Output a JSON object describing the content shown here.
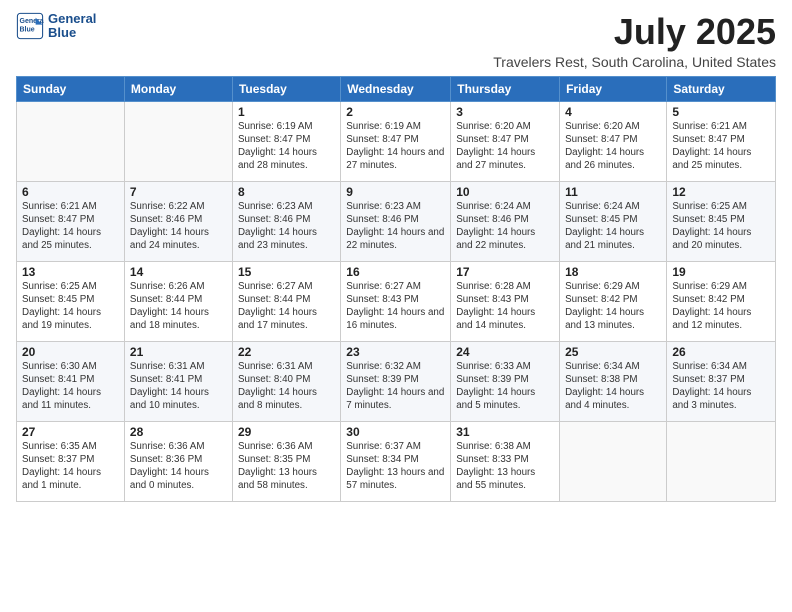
{
  "logo": {
    "line1": "General",
    "line2": "Blue"
  },
  "title": "July 2025",
  "subtitle": "Travelers Rest, South Carolina, United States",
  "days_of_week": [
    "Sunday",
    "Monday",
    "Tuesday",
    "Wednesday",
    "Thursday",
    "Friday",
    "Saturday"
  ],
  "weeks": [
    [
      {
        "day": "",
        "info": ""
      },
      {
        "day": "",
        "info": ""
      },
      {
        "day": "1",
        "info": "Sunrise: 6:19 AM\nSunset: 8:47 PM\nDaylight: 14 hours and 28 minutes."
      },
      {
        "day": "2",
        "info": "Sunrise: 6:19 AM\nSunset: 8:47 PM\nDaylight: 14 hours and 27 minutes."
      },
      {
        "day": "3",
        "info": "Sunrise: 6:20 AM\nSunset: 8:47 PM\nDaylight: 14 hours and 27 minutes."
      },
      {
        "day": "4",
        "info": "Sunrise: 6:20 AM\nSunset: 8:47 PM\nDaylight: 14 hours and 26 minutes."
      },
      {
        "day": "5",
        "info": "Sunrise: 6:21 AM\nSunset: 8:47 PM\nDaylight: 14 hours and 25 minutes."
      }
    ],
    [
      {
        "day": "6",
        "info": "Sunrise: 6:21 AM\nSunset: 8:47 PM\nDaylight: 14 hours and 25 minutes."
      },
      {
        "day": "7",
        "info": "Sunrise: 6:22 AM\nSunset: 8:46 PM\nDaylight: 14 hours and 24 minutes."
      },
      {
        "day": "8",
        "info": "Sunrise: 6:23 AM\nSunset: 8:46 PM\nDaylight: 14 hours and 23 minutes."
      },
      {
        "day": "9",
        "info": "Sunrise: 6:23 AM\nSunset: 8:46 PM\nDaylight: 14 hours and 22 minutes."
      },
      {
        "day": "10",
        "info": "Sunrise: 6:24 AM\nSunset: 8:46 PM\nDaylight: 14 hours and 22 minutes."
      },
      {
        "day": "11",
        "info": "Sunrise: 6:24 AM\nSunset: 8:45 PM\nDaylight: 14 hours and 21 minutes."
      },
      {
        "day": "12",
        "info": "Sunrise: 6:25 AM\nSunset: 8:45 PM\nDaylight: 14 hours and 20 minutes."
      }
    ],
    [
      {
        "day": "13",
        "info": "Sunrise: 6:25 AM\nSunset: 8:45 PM\nDaylight: 14 hours and 19 minutes."
      },
      {
        "day": "14",
        "info": "Sunrise: 6:26 AM\nSunset: 8:44 PM\nDaylight: 14 hours and 18 minutes."
      },
      {
        "day": "15",
        "info": "Sunrise: 6:27 AM\nSunset: 8:44 PM\nDaylight: 14 hours and 17 minutes."
      },
      {
        "day": "16",
        "info": "Sunrise: 6:27 AM\nSunset: 8:43 PM\nDaylight: 14 hours and 16 minutes."
      },
      {
        "day": "17",
        "info": "Sunrise: 6:28 AM\nSunset: 8:43 PM\nDaylight: 14 hours and 14 minutes."
      },
      {
        "day": "18",
        "info": "Sunrise: 6:29 AM\nSunset: 8:42 PM\nDaylight: 14 hours and 13 minutes."
      },
      {
        "day": "19",
        "info": "Sunrise: 6:29 AM\nSunset: 8:42 PM\nDaylight: 14 hours and 12 minutes."
      }
    ],
    [
      {
        "day": "20",
        "info": "Sunrise: 6:30 AM\nSunset: 8:41 PM\nDaylight: 14 hours and 11 minutes."
      },
      {
        "day": "21",
        "info": "Sunrise: 6:31 AM\nSunset: 8:41 PM\nDaylight: 14 hours and 10 minutes."
      },
      {
        "day": "22",
        "info": "Sunrise: 6:31 AM\nSunset: 8:40 PM\nDaylight: 14 hours and 8 minutes."
      },
      {
        "day": "23",
        "info": "Sunrise: 6:32 AM\nSunset: 8:39 PM\nDaylight: 14 hours and 7 minutes."
      },
      {
        "day": "24",
        "info": "Sunrise: 6:33 AM\nSunset: 8:39 PM\nDaylight: 14 hours and 5 minutes."
      },
      {
        "day": "25",
        "info": "Sunrise: 6:34 AM\nSunset: 8:38 PM\nDaylight: 14 hours and 4 minutes."
      },
      {
        "day": "26",
        "info": "Sunrise: 6:34 AM\nSunset: 8:37 PM\nDaylight: 14 hours and 3 minutes."
      }
    ],
    [
      {
        "day": "27",
        "info": "Sunrise: 6:35 AM\nSunset: 8:37 PM\nDaylight: 14 hours and 1 minute."
      },
      {
        "day": "28",
        "info": "Sunrise: 6:36 AM\nSunset: 8:36 PM\nDaylight: 14 hours and 0 minutes."
      },
      {
        "day": "29",
        "info": "Sunrise: 6:36 AM\nSunset: 8:35 PM\nDaylight: 13 hours and 58 minutes."
      },
      {
        "day": "30",
        "info": "Sunrise: 6:37 AM\nSunset: 8:34 PM\nDaylight: 13 hours and 57 minutes."
      },
      {
        "day": "31",
        "info": "Sunrise: 6:38 AM\nSunset: 8:33 PM\nDaylight: 13 hours and 55 minutes."
      },
      {
        "day": "",
        "info": ""
      },
      {
        "day": "",
        "info": ""
      }
    ]
  ]
}
